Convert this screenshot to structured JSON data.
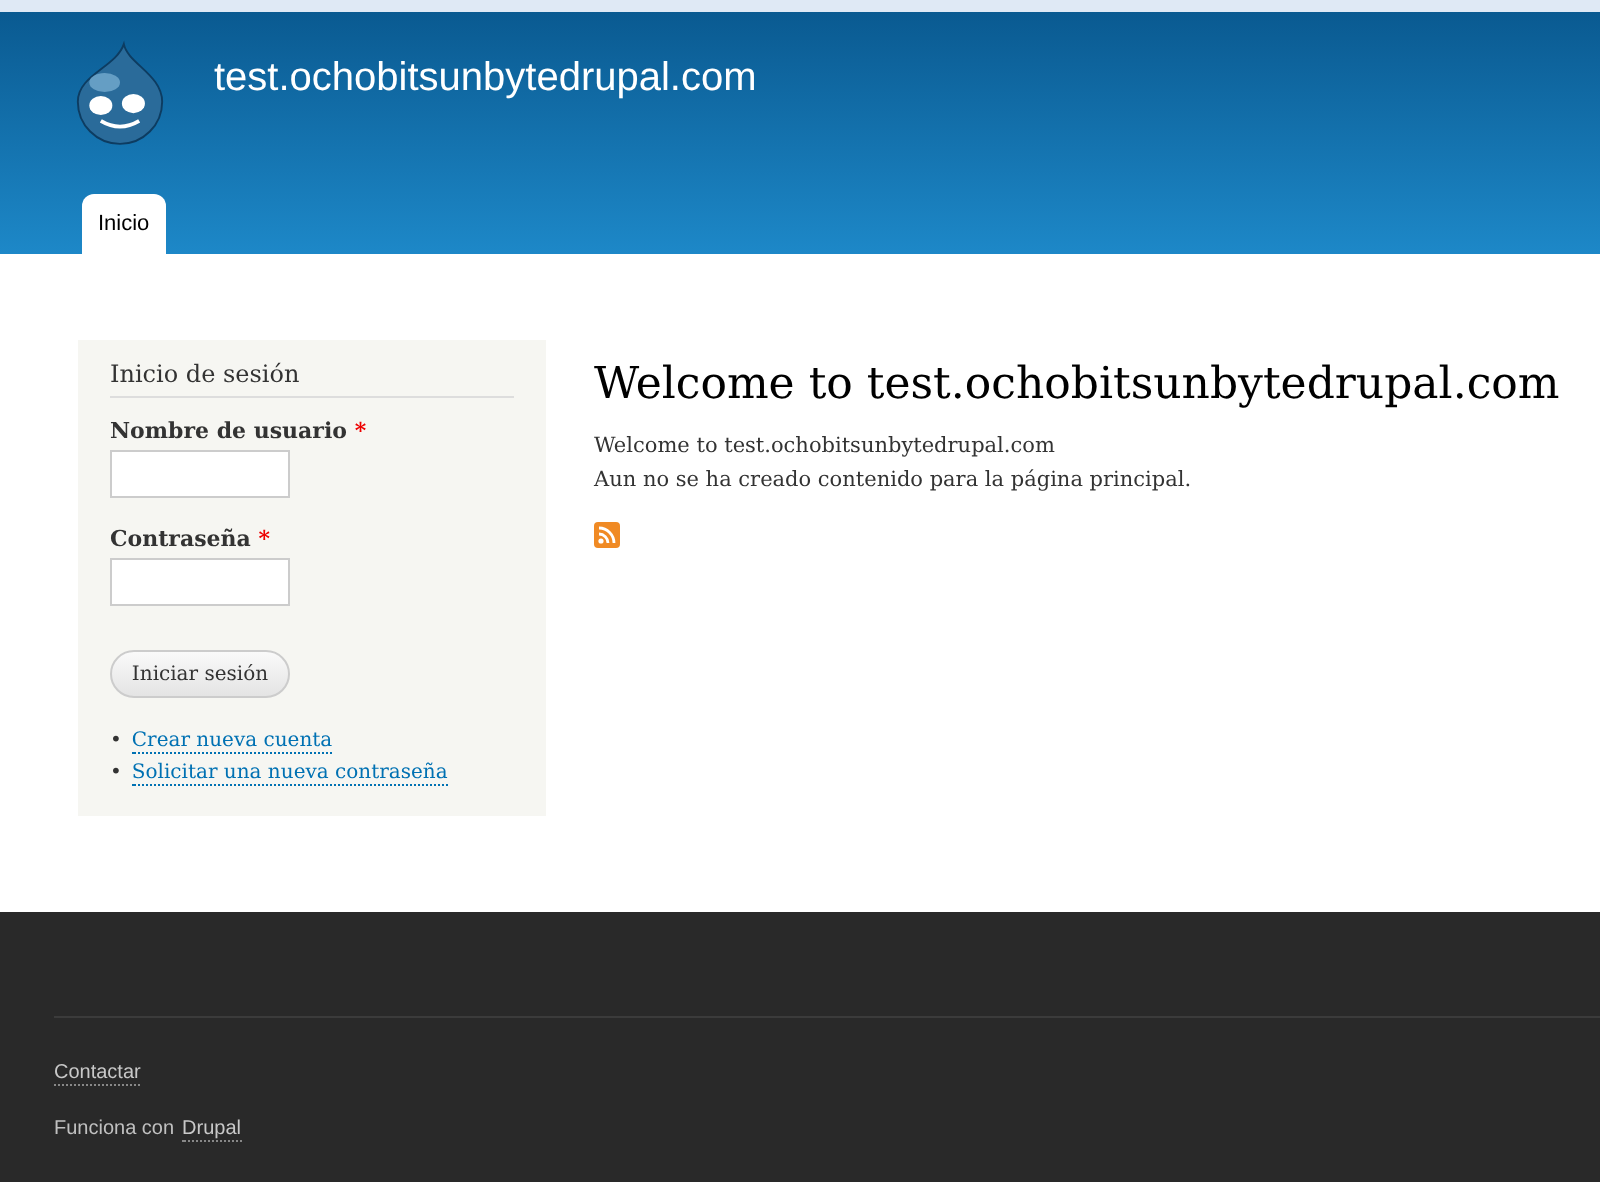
{
  "header": {
    "site_name": "test.ochobitsunbytedrupal.com",
    "tabs": [
      {
        "label": "Inicio",
        "selected": true
      }
    ]
  },
  "login": {
    "title": "Inicio de sesión",
    "fields": [
      {
        "label": "Nombre de usuario",
        "required_mark": "*"
      },
      {
        "label": "Contraseña",
        "required_mark": "*"
      }
    ],
    "submit": "Iniciar sesión",
    "links": [
      {
        "marker": "•",
        "text": "Crear nueva cuenta"
      },
      {
        "marker": "•",
        "text": "Solicitar una nueva contraseña"
      }
    ]
  },
  "main": {
    "title": "Welcome to test.ochobitsunbytedrupal.com",
    "lines": [
      "Welcome to test.ochobitsunbytedrupal.com",
      "Aun no se ha creado contenido para la página principal."
    ]
  },
  "footer": {
    "menu": [
      "Contactar"
    ],
    "credit": {
      "text": "Funciona con",
      "link": "Drupal"
    }
  }
}
